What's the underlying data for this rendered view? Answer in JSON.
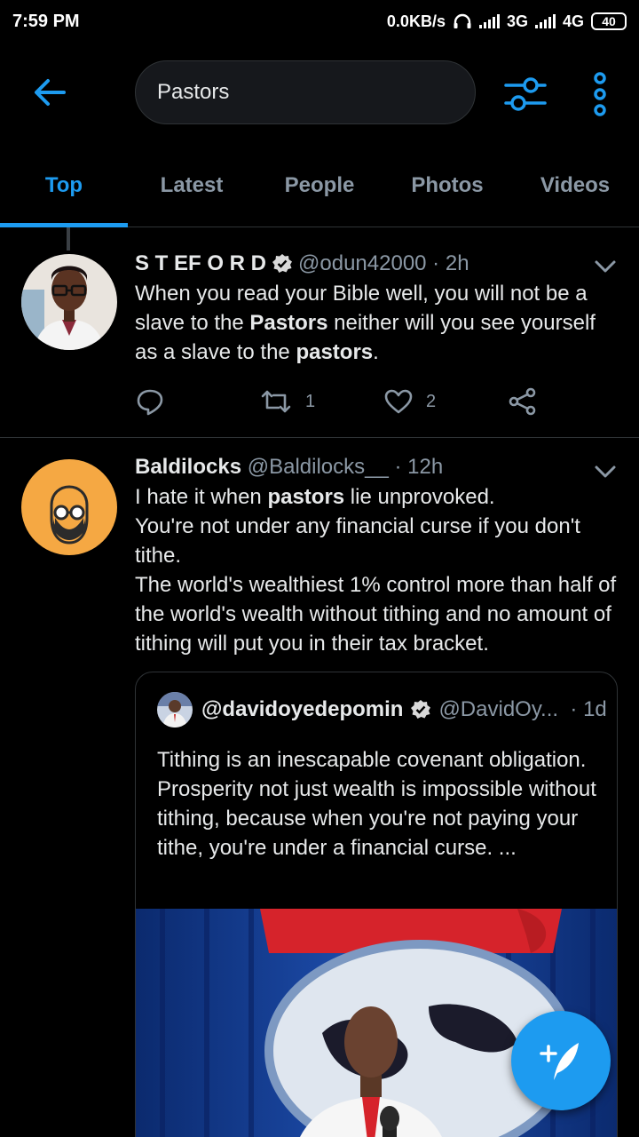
{
  "status_bar": {
    "time": "7:59 PM",
    "net_speed": "0.0KB/s",
    "net1": "3G",
    "net2": "4G",
    "battery": "40"
  },
  "search": {
    "query": "Pastors"
  },
  "tabs": [
    {
      "label": "Top",
      "active": true
    },
    {
      "label": "Latest"
    },
    {
      "label": "People"
    },
    {
      "label": "Photos"
    },
    {
      "label": "Videos"
    }
  ],
  "tweets": [
    {
      "name": "S T EF O R D",
      "handle": "@odun42000",
      "time": "2h",
      "text_parts": [
        "When you read your Bible well, you will not be a slave to the ",
        "Pastors",
        " neither will you see yourself as a slave to the ",
        "pastors",
        "."
      ],
      "retweets": "1",
      "likes": "2"
    },
    {
      "name": "Baldilocks",
      "handle": "@Baldilocks__",
      "time": "12h",
      "line1_parts": [
        "I hate it when ",
        "pastors",
        " lie unprovoked."
      ],
      "line2": "You're not under any financial curse if you don't tithe.",
      "line3": "The world's wealthiest 1% control more than half of the world's wealth without tithing and no amount of tithing will put you in their tax bracket.",
      "quote": {
        "name": "@davidoyedepomin",
        "handle": "@DavidOy...",
        "time": "1d",
        "text": "Tithing is an inescapable covenant obligation. Prosperity not just wealth is impossible without tithing, because when you're not paying your tithe, you're under a financial curse. ..."
      }
    }
  ],
  "colors": {
    "accent": "#1d9bf0",
    "background": "#000000",
    "muted": "#8b98a5"
  }
}
